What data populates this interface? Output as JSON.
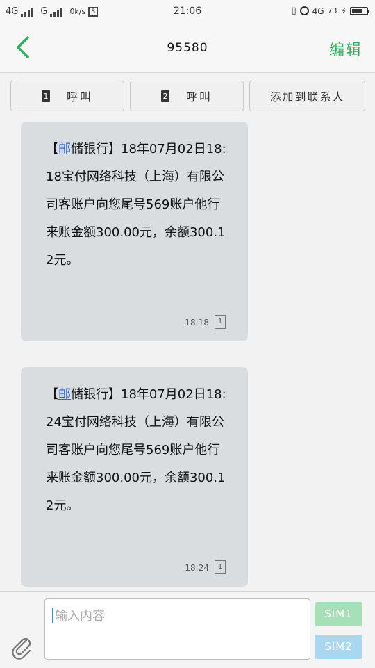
{
  "status_bar": {
    "network1": "4G",
    "network2": "G",
    "speed": "0k/s",
    "time": "21:06",
    "right_network": "4G",
    "battery": "73"
  },
  "header": {
    "title": "95580",
    "edit_label": "编辑"
  },
  "actions": {
    "call1_badge": "1",
    "call1_label": "呼叫",
    "call2_badge": "2",
    "call2_label": "呼叫",
    "add_contact_label": "添加到联系人"
  },
  "messages": [
    {
      "bracket_open": "【",
      "link_text": "邮",
      "text": "储银行】18年07月02日18:18宝付网络科技（上海）有限公司客账户向您尾号569账户他行来账金额300.00元，余额300.12元。",
      "time": "18:18",
      "sim": "1"
    },
    {
      "bracket_open": "【",
      "link_text": "邮",
      "text": "储银行】18年07月02日18:24宝付网络科技（上海）有限公司客账户向您尾号569账户他行来账金额300.00元，余额300.12元。",
      "time": "18:24",
      "sim": "1"
    }
  ],
  "input": {
    "placeholder": "输入内容",
    "sim1_label": "SIM1",
    "sim2_label": "SIM2"
  },
  "colors": {
    "accent_green": "#29b35a",
    "bubble": "#d9dde0",
    "link_blue": "#2c5fcf"
  }
}
